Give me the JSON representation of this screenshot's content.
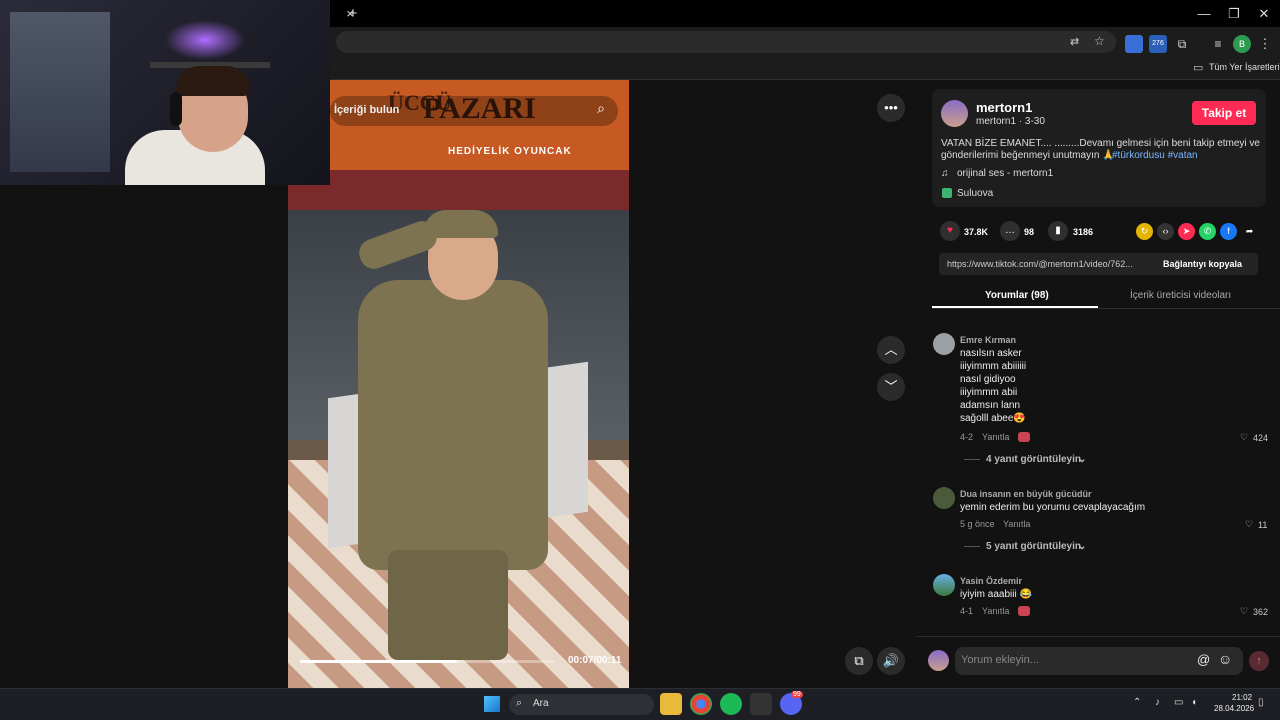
{
  "browser": {
    "tab_close": "×",
    "new_tab": "+",
    "controls": {
      "minimize": "—",
      "restore": "❐",
      "close": "✕"
    },
    "bookmarks_label": "Tüm Yer İşaretleri",
    "extension_badges": [
      "B"
    ],
    "ext_count": "276"
  },
  "webcam": {},
  "video": {
    "sign_text": "PAZARI",
    "sign_partial": "ÜCCÜ",
    "sign_sub": "HEDİYELİK   OYUNCAK",
    "search_placeholder": "İçeriği bulun",
    "time": "00:07/00:11",
    "progress_fraction": 0.62
  },
  "side_controls": {
    "more": "•••",
    "up": "︿",
    "down": "﹀",
    "volume": "🔊",
    "pip": "⧉"
  },
  "post": {
    "username": "mertorn1",
    "handle_date": "mertorn1 · 3-30",
    "follow_label": "Takip et",
    "caption_line1": "VATAN BİZE EMANET.... .........Devamı gelmesi için beni takip etmeyi ve",
    "caption_line2": "gönderilerimi beğenmeyi unutmayın 🙏",
    "hashtags": "#türkordusu #vatan",
    "sound": "orijinal ses - mertorn1",
    "location": "Suluova"
  },
  "stats": {
    "likes": "37.8K",
    "comments": "98",
    "saves": "3186"
  },
  "link": {
    "url": "https://www.tiktok.com/@mertorn1/video/762...",
    "copy_label": "Bağlantıyı kopyala"
  },
  "tabs": {
    "comments": "Yorumlar (98)",
    "creator_videos": "İçerik üreticisi videoları"
  },
  "comments": [
    {
      "name": "Emre Kırman",
      "lines": [
        "nasılsın asker",
        "iiiyimmm abiiiiii",
        "nasıl gidiyoo",
        "iiiyimmm abii",
        "adamsın lann",
        "sağolll abee😍"
      ],
      "date": "4-2",
      "reply": "Yanıtla",
      "likes": "424",
      "more": "4 yanıt görüntüleyin"
    },
    {
      "name": "Dua insanın en büyük gücüdür",
      "lines": [
        "yemin ederim bu yorumu cevaplayacağım"
      ],
      "date": "5 g önce",
      "reply": "Yanıtla",
      "likes": "11",
      "more": "5 yanıt görüntüleyin"
    },
    {
      "name": "Yasin Özdemir",
      "lines": [
        "iyiyim aaabiii 😂"
      ],
      "date": "4-1",
      "reply": "Yanıtla",
      "likes": "362"
    }
  ],
  "comment_input": {
    "placeholder": "Yorum ekleyin...",
    "mention": "@",
    "emoji": "☺",
    "send": "↑"
  },
  "taskbar": {
    "search": "Ara",
    "time": "21:02",
    "date": "28.04.2026",
    "discord_badge": "99"
  },
  "colors": {
    "accent": "#fe2c55",
    "hashtag": "#7cb8ff"
  }
}
